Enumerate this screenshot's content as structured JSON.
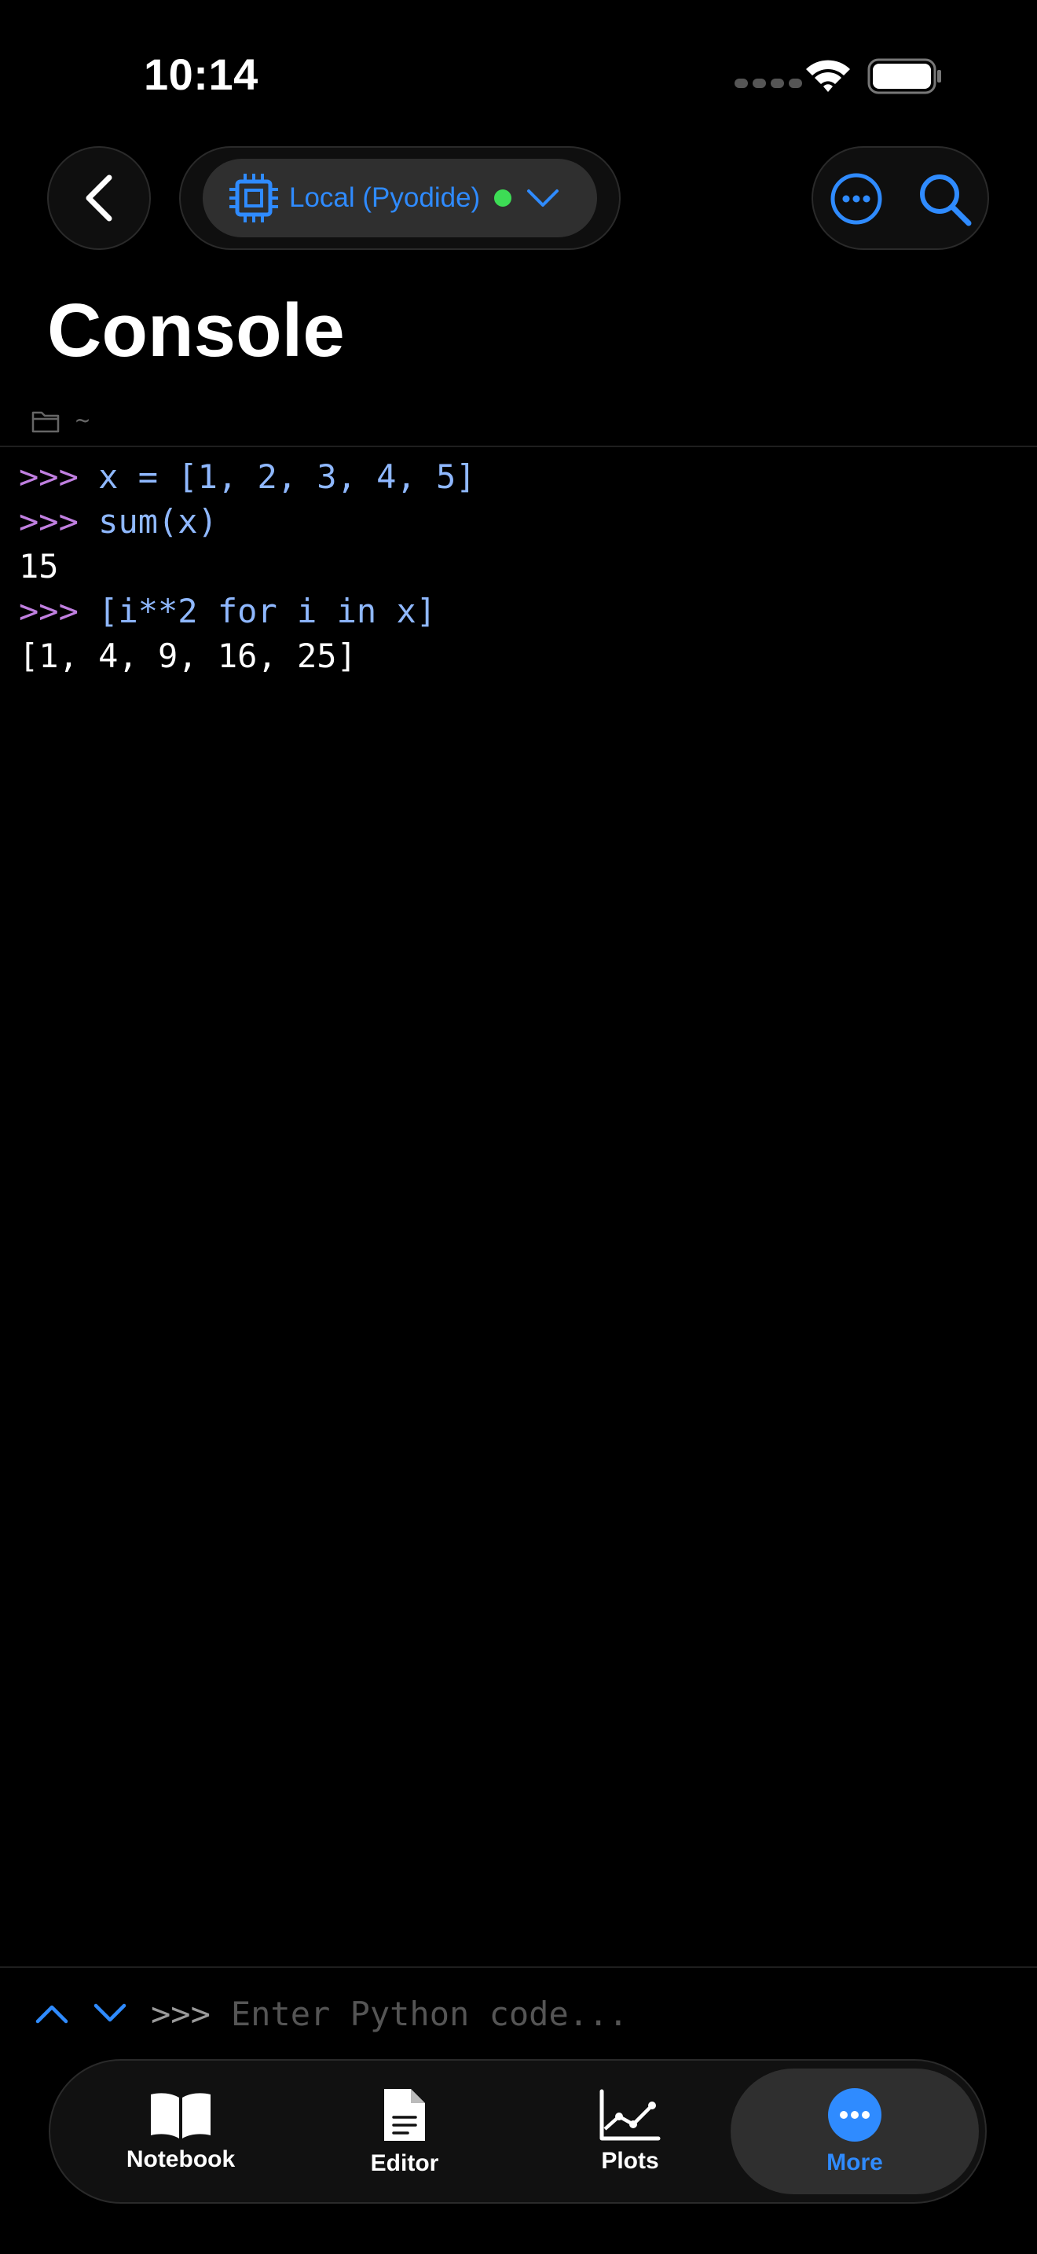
{
  "status_bar": {
    "time": "10:14"
  },
  "nav": {
    "kernel_label": "Local (Pyodide)",
    "kernel_status_color": "#3ddc55"
  },
  "page_title": "Console",
  "path": "~",
  "console": {
    "lines": [
      {
        "prompt": ">>>",
        "code": "x = [1, 2, 3, 4, 5]"
      },
      {
        "prompt": ">>>",
        "code": "sum(x)"
      },
      {
        "output": "15"
      },
      {
        "prompt": ">>>",
        "code": "[i**2 for i in x]"
      },
      {
        "output": "[1, 4, 9, 16, 25]"
      }
    ]
  },
  "input": {
    "prompt": ">>>",
    "placeholder": "Enter Python code..."
  },
  "tabs": [
    {
      "label": "Notebook",
      "icon": "book-icon"
    },
    {
      "label": "Editor",
      "icon": "document-icon"
    },
    {
      "label": "Plots",
      "icon": "chart-icon"
    },
    {
      "label": "More",
      "icon": "more-icon",
      "active": true
    }
  ],
  "colors": {
    "accent": "#2f8bff",
    "prompt": "#c07fe0",
    "code": "#8fb8ff"
  }
}
